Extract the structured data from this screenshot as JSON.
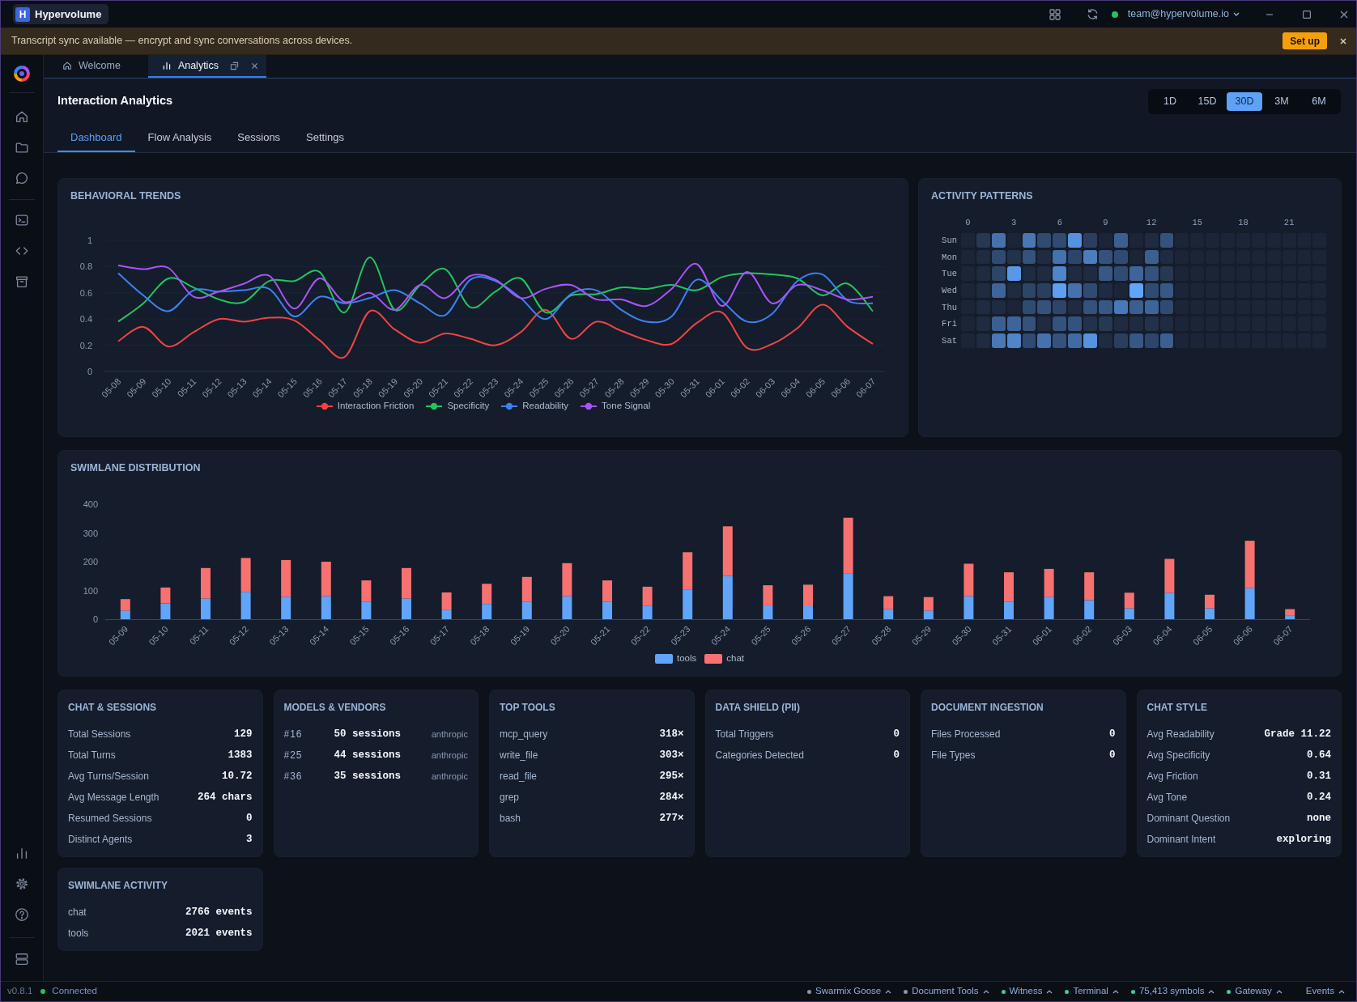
{
  "title_bar": {
    "logo_letter": "H",
    "app_name": "Hypervolume",
    "account": "team@hypervolume.io"
  },
  "banner": {
    "message": "Transcript sync available — encrypt and sync conversations across devices.",
    "action": "Set up"
  },
  "doc_tabs": [
    {
      "label": "Welcome",
      "selected": false
    },
    {
      "label": "Analytics",
      "selected": true
    }
  ],
  "header": {
    "title": "Interaction Analytics",
    "ranges": [
      {
        "label": "1D",
        "selected": false
      },
      {
        "label": "15D",
        "selected": false
      },
      {
        "label": "30D",
        "selected": true
      },
      {
        "label": "3M",
        "selected": false
      },
      {
        "label": "6M",
        "selected": false
      }
    ]
  },
  "nav_tabs": [
    {
      "label": "Dashboard",
      "selected": true
    },
    {
      "label": "Flow Analysis",
      "selected": false
    },
    {
      "label": "Sessions",
      "selected": false
    },
    {
      "label": "Settings",
      "selected": false
    }
  ],
  "behavioral_trends": {
    "chart_data": {
      "type": "line",
      "title": "BEHAVIORAL TRENDS",
      "grid": true,
      "categories": [
        "05-08",
        "05-09",
        "05-10",
        "05-11",
        "05-12",
        "05-13",
        "05-14",
        "05-15",
        "05-16",
        "05-17",
        "05-18",
        "05-19",
        "05-20",
        "05-21",
        "05-22",
        "05-23",
        "05-24",
        "05-25",
        "05-26",
        "05-27",
        "05-28",
        "05-29",
        "05-30",
        "05-31",
        "06-01",
        "06-02",
        "06-03",
        "06-04",
        "06-05",
        "06-06",
        "06-07"
      ],
      "ylim": [
        0,
        1
      ],
      "yticks": [
        0,
        0.2,
        0.4,
        0.6,
        0.8,
        1
      ],
      "series": [
        {
          "name": "Interaction Friction",
          "color": "#ef4444",
          "values": [
            0.23,
            0.34,
            0.19,
            0.3,
            0.4,
            0.38,
            0.41,
            0.39,
            0.24,
            0.11,
            0.46,
            0.32,
            0.22,
            0.29,
            0.25,
            0.2,
            0.3,
            0.47,
            0.25,
            0.38,
            0.31,
            0.24,
            0.21,
            0.37,
            0.45,
            0.18,
            0.21,
            0.33,
            0.51,
            0.34,
            0.21
          ]
        },
        {
          "name": "Specificity",
          "color": "#22c55e",
          "values": [
            0.38,
            0.52,
            0.71,
            0.64,
            0.55,
            0.53,
            0.69,
            0.69,
            0.76,
            0.45,
            0.87,
            0.47,
            0.66,
            0.78,
            0.49,
            0.61,
            0.71,
            0.45,
            0.58,
            0.59,
            0.64,
            0.63,
            0.66,
            0.62,
            0.72,
            0.75,
            0.74,
            0.71,
            0.58,
            0.67,
            0.46
          ]
        },
        {
          "name": "Readability",
          "color": "#3b82f6",
          "values": [
            0.75,
            0.58,
            0.46,
            0.62,
            0.61,
            0.62,
            0.63,
            0.42,
            0.57,
            0.52,
            0.56,
            0.62,
            0.52,
            0.43,
            0.7,
            0.69,
            0.56,
            0.4,
            0.59,
            0.62,
            0.47,
            0.38,
            0.42,
            0.7,
            0.54,
            0.38,
            0.44,
            0.69,
            0.74,
            0.54,
            0.52
          ]
        },
        {
          "name": "Tone Signal",
          "color": "#a855f7",
          "values": [
            0.81,
            0.78,
            0.79,
            0.57,
            0.61,
            0.67,
            0.73,
            0.48,
            0.71,
            0.53,
            0.6,
            0.47,
            0.66,
            0.56,
            0.73,
            0.7,
            0.56,
            0.63,
            0.66,
            0.55,
            0.55,
            0.5,
            0.63,
            0.82,
            0.5,
            0.76,
            0.52,
            0.66,
            0.62,
            0.55,
            0.57
          ]
        }
      ]
    }
  },
  "activity_patterns": {
    "title": "ACTIVITY PATTERNS",
    "hour_labels": [
      "0",
      "3",
      "6",
      "9",
      "12",
      "15",
      "18",
      "21"
    ],
    "rows": [
      {
        "day": "Sun",
        "cells": [
          {
            "color": "#1c2537"
          },
          {
            "color": "#263854"
          },
          {
            "color": "#4572ac"
          },
          {
            "color": "#1c2537"
          },
          {
            "color": "#4878b6"
          },
          {
            "color": "#304b72"
          },
          {
            "color": "#304b72"
          },
          {
            "color": "#5692dd"
          },
          {
            "color": "#2a3f5e"
          },
          {
            "color": "#1c2537"
          },
          {
            "color": "#3b5f8f"
          },
          {
            "color": "#1c2537"
          },
          {
            "color": "#1f2b41"
          },
          {
            "color": "#34527b"
          },
          {
            "color": "#1c2537"
          },
          {
            "color": "#1c2537"
          },
          {
            "color": "#1c2537"
          },
          {
            "color": "#1c2537"
          },
          {
            "color": "#1c2537"
          },
          {
            "color": "#1c2537"
          },
          {
            "color": "#1c2537"
          },
          {
            "color": "#1c2537"
          },
          {
            "color": "#1c2537"
          },
          {
            "color": "#1c2537"
          }
        ]
      },
      {
        "day": "Mon",
        "cells": [
          {
            "color": "#1c2537"
          },
          {
            "color": "#1f2b41"
          },
          {
            "color": "#304b72"
          },
          {
            "color": "#23324b"
          },
          {
            "color": "#34527b"
          },
          {
            "color": "#1f2b41"
          },
          {
            "color": "#4572ac"
          },
          {
            "color": "#2d4568"
          },
          {
            "color": "#4c7ebf"
          },
          {
            "color": "#34527b"
          },
          {
            "color": "#304b72"
          },
          {
            "color": "#1c2537"
          },
          {
            "color": "#3b5f8f"
          },
          {
            "color": "#1f2b41"
          },
          {
            "color": "#1c2537"
          },
          {
            "color": "#1c2537"
          },
          {
            "color": "#1c2537"
          },
          {
            "color": "#1c2537"
          },
          {
            "color": "#1c2537"
          },
          {
            "color": "#1c2537"
          },
          {
            "color": "#1c2537"
          },
          {
            "color": "#1c2537"
          },
          {
            "color": "#1c2537"
          },
          {
            "color": "#1c2537"
          }
        ]
      },
      {
        "day": "Tue",
        "cells": [
          {
            "color": "#1c2537"
          },
          {
            "color": "#1f2b41"
          },
          {
            "color": "#2d4568"
          },
          {
            "color": "#5998e7"
          },
          {
            "color": "#1f2b41"
          },
          {
            "color": "#1f2b41"
          },
          {
            "color": "#4f85c9"
          },
          {
            "color": "#1f2b41"
          },
          {
            "color": "#1f2b41"
          },
          {
            "color": "#375885"
          },
          {
            "color": "#304b72"
          },
          {
            "color": "#3e6599"
          },
          {
            "color": "#34527b"
          },
          {
            "color": "#263854"
          },
          {
            "color": "#1c2537"
          },
          {
            "color": "#1c2537"
          },
          {
            "color": "#1c2537"
          },
          {
            "color": "#1c2537"
          },
          {
            "color": "#1c2537"
          },
          {
            "color": "#1c2537"
          },
          {
            "color": "#1c2537"
          },
          {
            "color": "#1c2537"
          },
          {
            "color": "#1c2537"
          },
          {
            "color": "#1c2537"
          }
        ]
      },
      {
        "day": "Wed",
        "cells": [
          {
            "color": "#1c2537"
          },
          {
            "color": "#1f2b41"
          },
          {
            "color": "#3e6599"
          },
          {
            "color": "#1f2b41"
          },
          {
            "color": "#2d4568"
          },
          {
            "color": "#2a3f5e"
          },
          {
            "color": "#5d9ff0"
          },
          {
            "color": "#4572ac"
          },
          {
            "color": "#304b72"
          },
          {
            "color": "#1f2b41"
          },
          {
            "color": "#1c2537"
          },
          {
            "color": "#60a5fa"
          },
          {
            "color": "#304b72"
          },
          {
            "color": "#375885"
          },
          {
            "color": "#1c2537"
          },
          {
            "color": "#1c2537"
          },
          {
            "color": "#1c2537"
          },
          {
            "color": "#1c2537"
          },
          {
            "color": "#1c2537"
          },
          {
            "color": "#1c2537"
          },
          {
            "color": "#1c2537"
          },
          {
            "color": "#1c2537"
          },
          {
            "color": "#1c2537"
          },
          {
            "color": "#1c2537"
          }
        ]
      },
      {
        "day": "Thu",
        "cells": [
          {
            "color": "#1c2537"
          },
          {
            "color": "#1f2b41"
          },
          {
            "color": "#1f2b41"
          },
          {
            "color": "#1c2537"
          },
          {
            "color": "#304b72"
          },
          {
            "color": "#34527b"
          },
          {
            "color": "#2d4568"
          },
          {
            "color": "#1f2b41"
          },
          {
            "color": "#34527b"
          },
          {
            "color": "#375885"
          },
          {
            "color": "#4878b6"
          },
          {
            "color": "#3b5f8f"
          },
          {
            "color": "#3e6599"
          },
          {
            "color": "#304b72"
          },
          {
            "color": "#1c2537"
          },
          {
            "color": "#1c2537"
          },
          {
            "color": "#1c2537"
          },
          {
            "color": "#1c2537"
          },
          {
            "color": "#1c2537"
          },
          {
            "color": "#1c2537"
          },
          {
            "color": "#1c2537"
          },
          {
            "color": "#1c2537"
          },
          {
            "color": "#1c2537"
          },
          {
            "color": "#1c2537"
          }
        ]
      },
      {
        "day": "Fri",
        "cells": [
          {
            "color": "#1c2537"
          },
          {
            "color": "#1f2b41"
          },
          {
            "color": "#3b5f8f"
          },
          {
            "color": "#3e6599"
          },
          {
            "color": "#34527b"
          },
          {
            "color": "#1f2b41"
          },
          {
            "color": "#34527b"
          },
          {
            "color": "#34527b"
          },
          {
            "color": "#23324b"
          },
          {
            "color": "#263854"
          },
          {
            "color": "#1f2b41"
          },
          {
            "color": "#1f2b41"
          },
          {
            "color": "#23324b"
          },
          {
            "color": "#1f2b41"
          },
          {
            "color": "#1c2537"
          },
          {
            "color": "#1c2537"
          },
          {
            "color": "#1c2537"
          },
          {
            "color": "#1c2537"
          },
          {
            "color": "#1c2537"
          },
          {
            "color": "#1c2537"
          },
          {
            "color": "#1c2537"
          },
          {
            "color": "#1c2537"
          },
          {
            "color": "#1c2537"
          },
          {
            "color": "#1c2537"
          }
        ]
      },
      {
        "day": "Sat",
        "cells": [
          {
            "color": "#1c2537"
          },
          {
            "color": "#1f2b41"
          },
          {
            "color": "#4878b6"
          },
          {
            "color": "#4f85c9"
          },
          {
            "color": "#304b72"
          },
          {
            "color": "#4572ac"
          },
          {
            "color": "#34527b"
          },
          {
            "color": "#416ba2"
          },
          {
            "color": "#5692dd"
          },
          {
            "color": "#1f2b41"
          },
          {
            "color": "#2a3f5e"
          },
          {
            "color": "#375885"
          },
          {
            "color": "#2d4568"
          },
          {
            "color": "#3b5f8f"
          },
          {
            "color": "#1c2537"
          },
          {
            "color": "#1c2537"
          },
          {
            "color": "#1c2537"
          },
          {
            "color": "#1c2537"
          },
          {
            "color": "#1c2537"
          },
          {
            "color": "#1c2537"
          },
          {
            "color": "#1c2537"
          },
          {
            "color": "#1c2537"
          },
          {
            "color": "#1c2537"
          },
          {
            "color": "#1c2537"
          }
        ]
      }
    ]
  },
  "swimlane_distribution": {
    "chart_data": {
      "type": "bar",
      "title": "SWIMLANE DISTRIBUTION",
      "stacked": true,
      "categories": [
        "05-09",
        "05-10",
        "05-11",
        "05-12",
        "05-13",
        "05-14",
        "05-15",
        "05-16",
        "05-17",
        "05-18",
        "05-19",
        "05-20",
        "05-21",
        "05-22",
        "05-23",
        "05-24",
        "05-25",
        "05-26",
        "05-27",
        "05-28",
        "05-29",
        "05-30",
        "05-31",
        "06-01",
        "06-02",
        "06-03",
        "06-04",
        "06-05",
        "06-06",
        "06-07"
      ],
      "ylim": [
        0,
        400
      ],
      "yticks": [
        0,
        100,
        200,
        300,
        400
      ],
      "series": [
        {
          "name": "tools",
          "color": "#60a5fa",
          "values": [
            30,
            55,
            72,
            95,
            78,
            80,
            60,
            72,
            32,
            53,
            60,
            80,
            60,
            47,
            102,
            150,
            48,
            45,
            160,
            35,
            30,
            80,
            60,
            78,
            66,
            38,
            92,
            38,
            108,
            12
          ]
        },
        {
          "name": "chat",
          "color": "#f87171",
          "values": [
            40,
            55,
            106,
            118,
            128,
            120,
            75,
            106,
            61,
            70,
            87,
            115,
            75,
            66,
            131,
            173,
            70,
            75,
            193,
            45,
            47,
            113,
            103,
            97,
            97,
            54,
            118,
            47,
            165,
            23
          ]
        }
      ]
    }
  },
  "stat_cards": [
    {
      "title": "CHAT & SESSIONS",
      "kind": "metrics",
      "rows": [
        {
          "label": "Total Sessions",
          "value": "129"
        },
        {
          "label": "Total Turns",
          "value": "1383"
        },
        {
          "label": "Avg Turns/Session",
          "value": "10.72"
        },
        {
          "label": "Avg Message Length",
          "value": "264 chars"
        },
        {
          "label": "Resumed Sessions",
          "value": "0"
        },
        {
          "label": "Distinct Agents",
          "value": "3"
        }
      ]
    },
    {
      "title": "MODELS & VENDORS",
      "kind": "models",
      "rows": [
        {
          "rank": "#16",
          "sessions": "50 sessions",
          "vendor": "anthropic"
        },
        {
          "rank": "#25",
          "sessions": "44 sessions",
          "vendor": "anthropic"
        },
        {
          "rank": "#36",
          "sessions": "35 sessions",
          "vendor": "anthropic"
        }
      ]
    },
    {
      "title": "TOP TOOLS",
      "kind": "metrics",
      "rows": [
        {
          "label": "mcp_query",
          "value": "318×"
        },
        {
          "label": "write_file",
          "value": "303×"
        },
        {
          "label": "read_file",
          "value": "295×"
        },
        {
          "label": "grep",
          "value": "284×"
        },
        {
          "label": "bash",
          "value": "277×"
        }
      ]
    },
    {
      "title": "DATA SHIELD (PII)",
      "kind": "metrics",
      "rows": [
        {
          "label": "Total Triggers",
          "value": "0"
        },
        {
          "label": "Categories Detected",
          "value": "0"
        }
      ]
    },
    {
      "title": "DOCUMENT INGESTION",
      "kind": "metrics",
      "rows": [
        {
          "label": "Files Processed",
          "value": "0"
        },
        {
          "label": "File Types",
          "value": "0"
        }
      ]
    },
    {
      "title": "CHAT STYLE",
      "kind": "metrics",
      "rows": [
        {
          "label": "Avg Readability",
          "value": "Grade 11.22"
        },
        {
          "label": "Avg Specificity",
          "value": "0.64"
        },
        {
          "label": "Avg Friction",
          "value": "0.31"
        },
        {
          "label": "Avg Tone",
          "value": "0.24"
        },
        {
          "label": "Dominant Question",
          "value": "none"
        },
        {
          "label": "Dominant Intent",
          "value": "exploring"
        }
      ]
    },
    {
      "title": "SWIMLANE ACTIVITY",
      "kind": "metrics",
      "rows": [
        {
          "label": "chat",
          "value": "2766 events"
        },
        {
          "label": "tools",
          "value": "2021 events"
        }
      ]
    }
  ],
  "status_bar": {
    "version": "v0.8.1",
    "connection": "Connected",
    "items": [
      {
        "label": "Swarmix Goose",
        "color": "#8b95a7"
      },
      {
        "label": "Document Tools",
        "color": "#8b95a7"
      },
      {
        "label": "Witness",
        "color": "#34d399"
      },
      {
        "label": "Terminal",
        "color": "#34d399"
      },
      {
        "label": "75,413 symbols",
        "color": "#34d399"
      },
      {
        "label": "Gateway",
        "color": "#34d399"
      },
      {
        "label": "Events"
      }
    ]
  }
}
